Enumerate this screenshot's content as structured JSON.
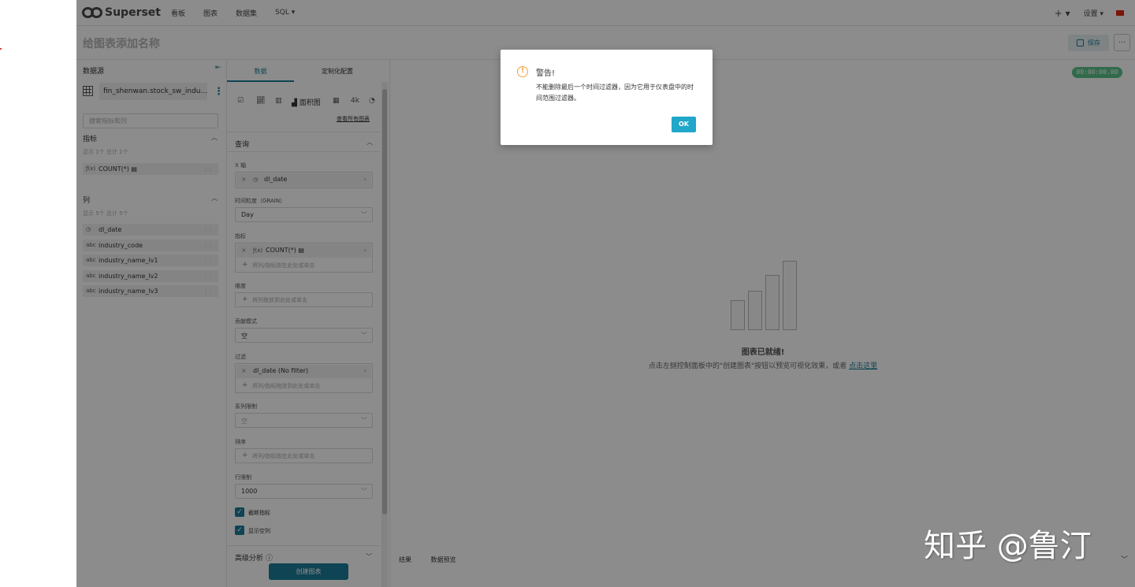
{
  "navbar": {
    "brand": "Superset",
    "items": [
      "看板",
      "图表",
      "数据集",
      "SQL ▾"
    ],
    "plus_label": "+ ▾",
    "settings_label": "设置 ▾"
  },
  "titlebar": {
    "chart_title": "给图表添加名称",
    "save_label": "保存",
    "more_label": "···"
  },
  "datasource": {
    "title": "数据源",
    "name": "fin_shenwan.stock_sw_indu...",
    "search_placeholder": "搜索指标和列",
    "metrics_title": "指标",
    "metrics_sub": "显示 1个 总计 1个",
    "metrics": [
      {
        "type": "ƒ(x)",
        "name": "COUNT(*)"
      }
    ],
    "columns_title": "列",
    "columns_sub": "显示 5个 总计 5个",
    "columns": [
      {
        "type": "◷",
        "name": "dl_date"
      },
      {
        "type": "abc",
        "name": "industry_code"
      },
      {
        "type": "abc",
        "name": "industry_name_lv1"
      },
      {
        "type": "abc",
        "name": "industry_name_lv2"
      },
      {
        "type": "abc",
        "name": "industry_name_lv3"
      }
    ]
  },
  "control": {
    "tab_data": "数据",
    "tab_custom": "定制化配置",
    "viz_current": "面积图",
    "viz_4k": "4k",
    "view_all": "查看所有图表",
    "query_title": "查询",
    "x_axis_label": "X 轴",
    "x_axis_value": "dl_date",
    "grain_label": "时间粒度（GRAIN）",
    "grain_value": "Day",
    "metrics_label": "指标",
    "metric_value": "COUNT(*)",
    "metric_drop_hint": "将列/指标放在此处或单击",
    "dimension_label": "维度",
    "dimension_hint": "将列拖放到此处或单击",
    "contribution_label": "贡献模式",
    "contribution_value": "空",
    "filter_label": "过滤",
    "filter_value": "dl_date (No filter)",
    "filter_hint": "将列/指标拖放到此处或单击",
    "series_limit_label": "系列限制",
    "series_limit_value": "空",
    "sort_label": "排序",
    "sort_hint": "将列/指标放在此处或单击",
    "row_limit_label": "行限制",
    "row_limit_value": "1000",
    "truncate_metric": "截断指标",
    "show_empty": "显示空列",
    "advanced": "高级分析 ⓘ",
    "create_btn": "创建图表"
  },
  "chart_area": {
    "timer": "00:00:00.00",
    "empty_title": "图表已就绪!",
    "empty_desc": "点击左侧控制面板中的\"创建图表\"按钮以预览可视化效果，或者 ",
    "empty_link": "点击这里",
    "bottom_tab_results": "结果",
    "bottom_tab_samples": "数据预览"
  },
  "modal": {
    "title": "警告!",
    "body": "不能删除最后一个时间过滤器，因为它用于仪表盘中的时间范围过滤器。",
    "ok": "OK"
  },
  "watermark": "知乎 @鲁汀"
}
